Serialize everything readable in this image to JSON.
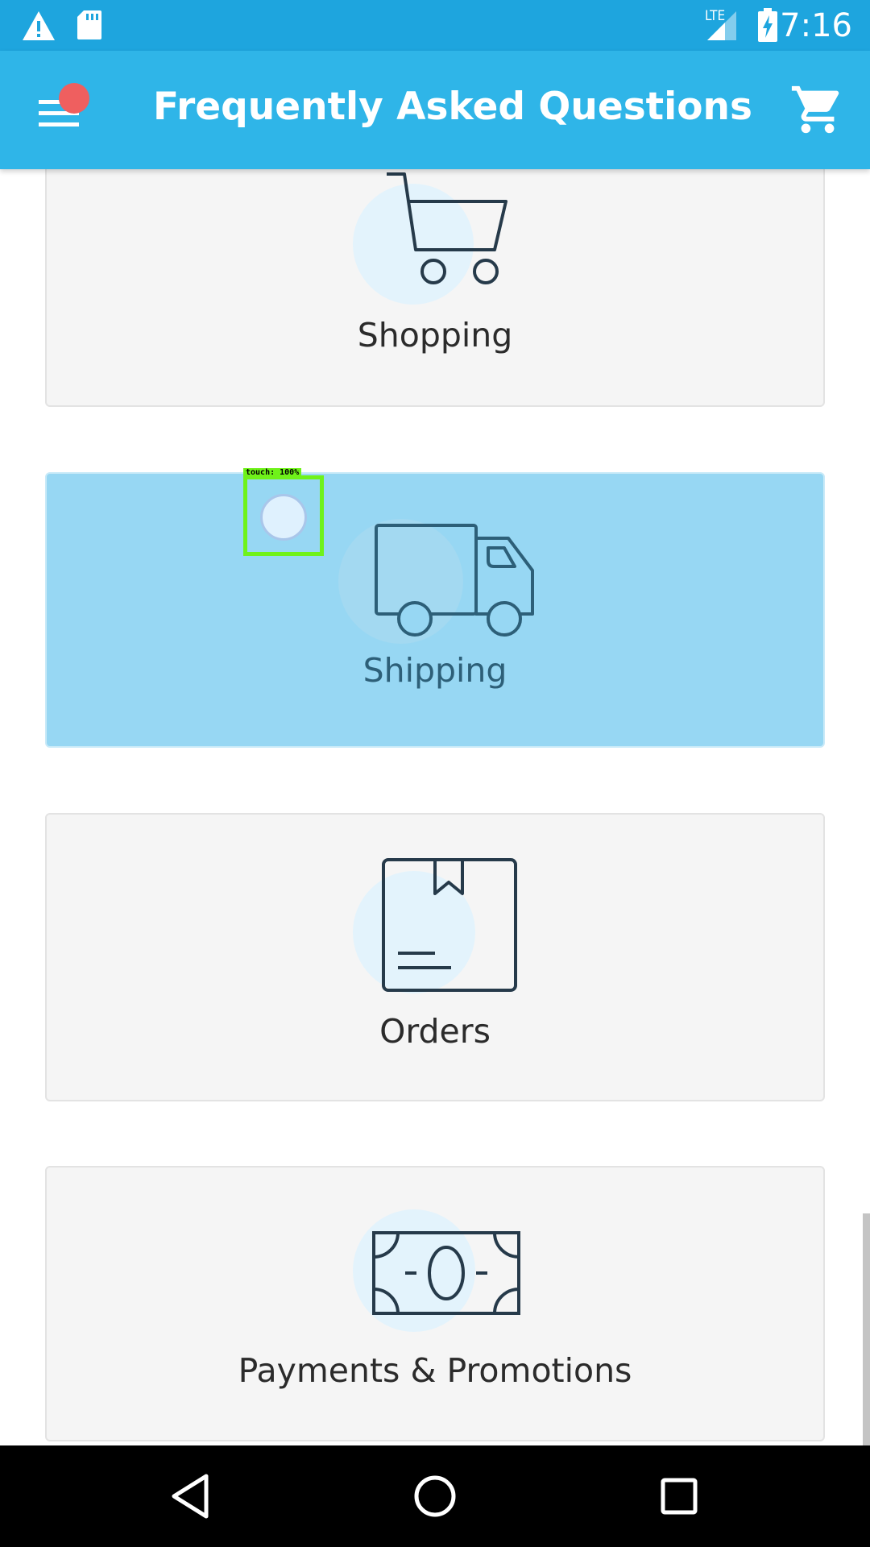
{
  "status_bar": {
    "time": "7:16",
    "network_label": "LTE",
    "icons": [
      "warning-icon",
      "sd-card-icon",
      "signal-icon",
      "battery-charging-icon"
    ]
  },
  "app_bar": {
    "title": "Frequently Asked Questions",
    "menu_icon": "hamburger-menu-icon",
    "cart_icon": "shopping-cart-icon",
    "accent_color": "#2fb5e8",
    "notification_color": "#ef5f5f"
  },
  "categories": [
    {
      "label": "Shopping",
      "icon": "shopping-cart-icon",
      "selected": false
    },
    {
      "label": "Shipping",
      "icon": "truck-icon",
      "selected": true
    },
    {
      "label": "Orders",
      "icon": "package-box-icon",
      "selected": false
    },
    {
      "label": "Payments & Promotions",
      "icon": "banknote-icon",
      "selected": false
    }
  ],
  "touch_overlay": {
    "label": "touch: 100%"
  },
  "nav_bar": {
    "icons": [
      "back-icon",
      "home-icon",
      "recents-icon"
    ]
  }
}
